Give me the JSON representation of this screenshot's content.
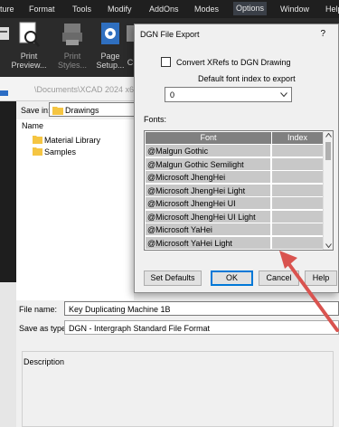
{
  "menu": [
    "ture",
    "Format",
    "Tools",
    "Modify",
    "AddOns",
    "Modes",
    "Options",
    "Window",
    "Help"
  ],
  "ribbon": {
    "print": "Print",
    "print_preview": "Preview...",
    "print_styles": "Print Styles...",
    "page": "Page",
    "page_setup": "Setup...",
    "partial": "C"
  },
  "path": "\\Documents\\XCAD 2024 x64\\D",
  "save_dialog": {
    "save_in_label": "Save in:",
    "save_in_value": "Drawings",
    "name_header": "Name",
    "items": [
      "Material Library",
      "Samples"
    ],
    "file_name_label": "File name:",
    "file_name_value": "Key Duplicating Machine 1B",
    "save_as_type_label": "Save as type:",
    "save_as_type_value": "DGN - Intergraph Standard File Format",
    "description_label": "Description"
  },
  "dgn_dialog": {
    "title": "DGN File Export",
    "help": "?",
    "convert_xrefs_label": "Convert XRefs to DGN Drawing",
    "convert_xrefs_checked": false,
    "font_index_label": "Default font index to export",
    "font_index_value": "0",
    "fonts_label": "Fonts:",
    "columns": [
      "Font",
      "Index"
    ],
    "fonts": [
      {
        "font": "@Malgun Gothic",
        "index": ""
      },
      {
        "font": "@Malgun Gothic Semilight",
        "index": ""
      },
      {
        "font": "@Microsoft JhengHei",
        "index": ""
      },
      {
        "font": "@Microsoft JhengHei Light",
        "index": ""
      },
      {
        "font": "@Microsoft JhengHei UI",
        "index": ""
      },
      {
        "font": "@Microsoft JhengHei UI Light",
        "index": ""
      },
      {
        "font": "@Microsoft YaHei",
        "index": ""
      },
      {
        "font": "@Microsoft YaHei Light",
        "index": ""
      }
    ],
    "buttons": {
      "set_defaults": "Set Defaults",
      "ok": "OK",
      "cancel": "Cancel",
      "help": "Help"
    }
  },
  "colors": {
    "menubar": "#1f1f1f",
    "ribbon": "#2b2b2b",
    "dialog": "#f0f0f0",
    "grid_header": "#808080",
    "grid_cell": "#c8c8c8",
    "accent": "#0078d7",
    "annotation_arrow": "#d9534f"
  }
}
